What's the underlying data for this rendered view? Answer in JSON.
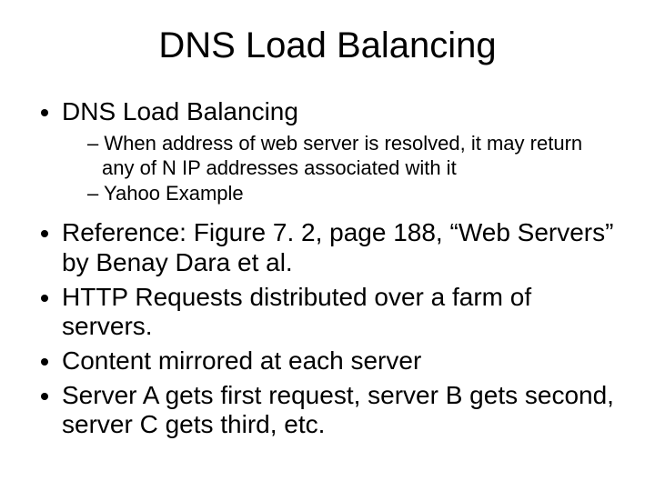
{
  "title": "DNS Load Balancing",
  "bullets": {
    "b1": {
      "text": "DNS Load Balancing",
      "sub": {
        "s1": "When address of web server is resolved, it may return any of N IP addresses associated with it",
        "s2": "Yahoo Example"
      }
    },
    "b2": "Reference: Figure 7. 2, page 188, “Web Servers” by Benay Dara et al.",
    "b3": "HTTP Requests distributed over a farm of servers.",
    "b4": "Content mirrored at each server",
    "b5": "Server A gets first request, server B gets second, server C gets third, etc."
  }
}
